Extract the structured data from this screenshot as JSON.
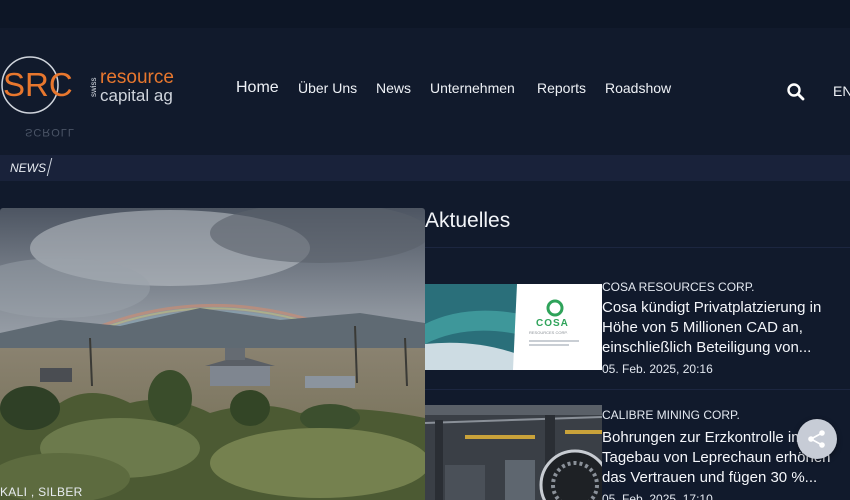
{
  "brand": {
    "logo_letters": "SRC",
    "logo_vertical": "swiss",
    "logo_line1": "resource",
    "logo_line2": "capital ag",
    "scroll_label": "SCROLL",
    "accent_color": "#e8772e"
  },
  "nav": {
    "items": [
      {
        "label": "Home"
      },
      {
        "label": "Über Uns"
      },
      {
        "label": "News"
      },
      {
        "label": "Unternehmen"
      },
      {
        "label": "Reports"
      },
      {
        "label": "Roadshow"
      }
    ],
    "search_icon": "search-icon",
    "language": "EN"
  },
  "breadcrumb": {
    "label": "NEWS"
  },
  "hero": {
    "tags": "KALI , SILBER"
  },
  "section": {
    "title": "Aktuelles"
  },
  "news": [
    {
      "company": "COSA RESOURCES CORP.",
      "title": "Cosa kündigt Privatplatzierung in Höhe von 5 Millionen CAD an, einschließlich Beteiligung von...",
      "date": "05. Feb. 2025, 20:16",
      "thumb_logo": "COSA",
      "thumb_subtitle": "RESOURCES CORP."
    },
    {
      "company": "CALIBRE MINING CORP.",
      "title": "Bohrungen zur Erzkontrolle im Tagebau von Leprechaun erhöhen das Vertrauen und fügen 30 %...",
      "date": "05. Feb. 2025, 17:10"
    }
  ],
  "share": {
    "icon": "share-icon"
  }
}
